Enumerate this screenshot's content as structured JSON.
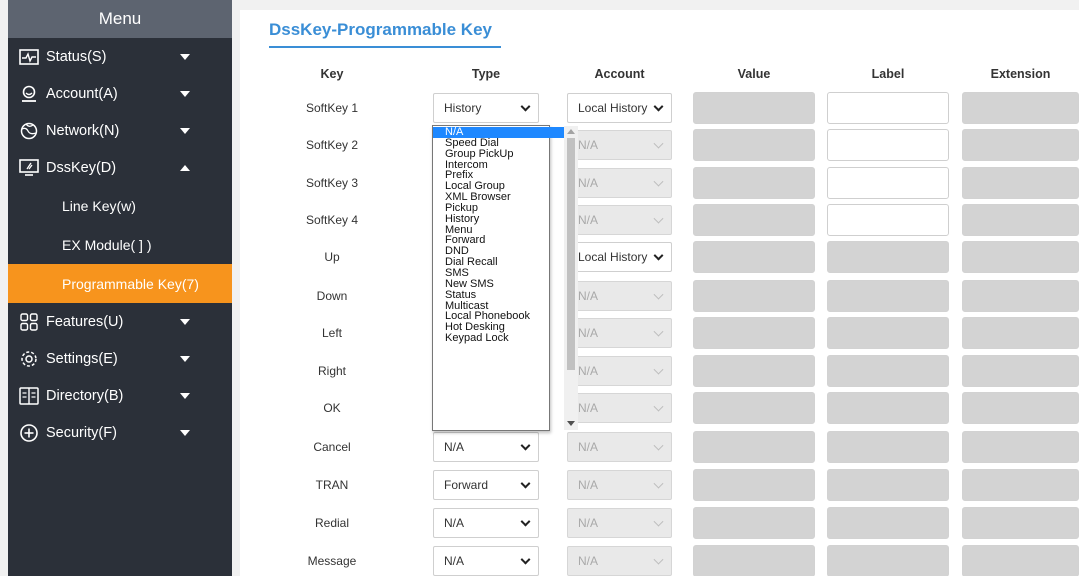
{
  "sidebar": {
    "title": "Menu",
    "items": [
      {
        "label": "Status(S)",
        "icon": "status-icon",
        "expanded": false
      },
      {
        "label": "Account(A)",
        "icon": "account-icon",
        "expanded": false
      },
      {
        "label": "Network(N)",
        "icon": "network-icon",
        "expanded": false
      },
      {
        "label": "DssKey(D)",
        "icon": "dsskey-icon",
        "expanded": true
      },
      {
        "label": "Features(U)",
        "icon": "features-icon",
        "expanded": false
      },
      {
        "label": "Settings(E)",
        "icon": "settings-icon",
        "expanded": false
      },
      {
        "label": "Directory(B)",
        "icon": "directory-icon",
        "expanded": false
      },
      {
        "label": "Security(F)",
        "icon": "security-icon",
        "expanded": false
      }
    ],
    "subitems": [
      {
        "label": "Line Key(w)"
      },
      {
        "label": "EX Module( ] )"
      },
      {
        "label": "Programmable Key(7)",
        "active": true
      }
    ],
    "colors": {
      "bg": "#2b3039",
      "header": "#5d6470",
      "active": "#f7941d"
    }
  },
  "main": {
    "title": "DssKey-Programmable Key",
    "title_color": "#3a8ed6",
    "columns": [
      "Key",
      "Type",
      "Account",
      "Value",
      "Label",
      "Extension"
    ],
    "rows": [
      {
        "key": "SoftKey 1",
        "type": "History",
        "account": "Local History",
        "account_enabled": true,
        "label_editable": true
      },
      {
        "key": "SoftKey 2",
        "type": "",
        "account": "N/A",
        "account_enabled": false,
        "label_editable": true
      },
      {
        "key": "SoftKey 3",
        "type": "",
        "account": "N/A",
        "account_enabled": false,
        "label_editable": true
      },
      {
        "key": "SoftKey 4",
        "type": "",
        "account": "N/A",
        "account_enabled": false,
        "label_editable": true
      },
      {
        "key": "Up",
        "type": "",
        "account": "Local History",
        "account_enabled": true,
        "label_editable": false
      },
      {
        "key": "Down",
        "type": "",
        "account": "N/A",
        "account_enabled": false,
        "label_editable": false
      },
      {
        "key": "Left",
        "type": "",
        "account": "N/A",
        "account_enabled": false,
        "label_editable": false
      },
      {
        "key": "Right",
        "type": "",
        "account": "N/A",
        "account_enabled": false,
        "label_editable": false
      },
      {
        "key": "OK",
        "type": "",
        "account": "N/A",
        "account_enabled": false,
        "label_editable": false
      },
      {
        "key": "Cancel",
        "type": "N/A",
        "account": "N/A",
        "account_enabled": false,
        "label_editable": false
      },
      {
        "key": "TRAN",
        "type": "Forward",
        "account": "N/A",
        "account_enabled": false,
        "label_editable": false
      },
      {
        "key": "Redial",
        "type": "N/A",
        "account": "N/A",
        "account_enabled": false,
        "label_editable": false
      },
      {
        "key": "Message",
        "type": "N/A",
        "account": "N/A",
        "account_enabled": false,
        "label_editable": false
      }
    ],
    "dropdown": {
      "highlighted": "N/A",
      "options": [
        "N/A",
        "Speed Dial",
        "Group PickUp",
        "Intercom",
        "Prefix",
        "Local Group",
        "XML Browser",
        "Pickup",
        "History",
        "Menu",
        "Forward",
        "DND",
        "Dial Recall",
        "SMS",
        "New SMS",
        "Status",
        "Multicast",
        "Local Phonebook",
        "Hot Desking",
        "Keypad Lock"
      ]
    }
  }
}
